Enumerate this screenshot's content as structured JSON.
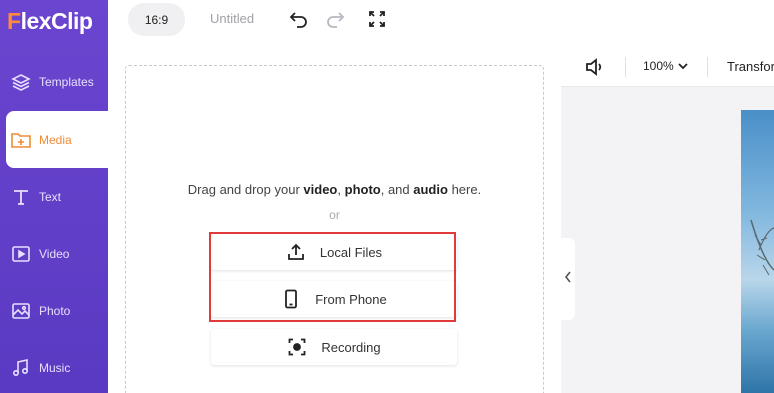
{
  "app": {
    "logo_text_rest": "lexClip",
    "logo_letter": "F"
  },
  "sidebar": {
    "items": [
      {
        "label": "Templates",
        "icon": "layers-icon",
        "active": false
      },
      {
        "label": "Media",
        "icon": "media-folder-icon",
        "active": true
      },
      {
        "label": "Text",
        "icon": "text-icon",
        "active": false
      },
      {
        "label": "Video",
        "icon": "video-icon",
        "active": false
      },
      {
        "label": "Photo",
        "icon": "photo-icon",
        "active": false
      },
      {
        "label": "Music",
        "icon": "music-icon",
        "active": false
      }
    ]
  },
  "topbar": {
    "aspect_ratio": "16:9",
    "project_title": "Untitled"
  },
  "media_panel": {
    "drop_prefix": "Drag and drop your",
    "kind_video": "video",
    "kind_photo": "photo",
    "conj": ", and",
    "kind_audio": "audio",
    "drop_suffix": "here.",
    "or": "or",
    "buttons": {
      "local_files": "Local Files",
      "from_phone": "From Phone",
      "recording": "Recording"
    }
  },
  "canvas": {
    "zoom": "100%",
    "transform_label": "Transform"
  },
  "colors": {
    "sidebar": "#6b45cf",
    "active_text": "#f08a35",
    "highlight": "#e03a3a"
  }
}
